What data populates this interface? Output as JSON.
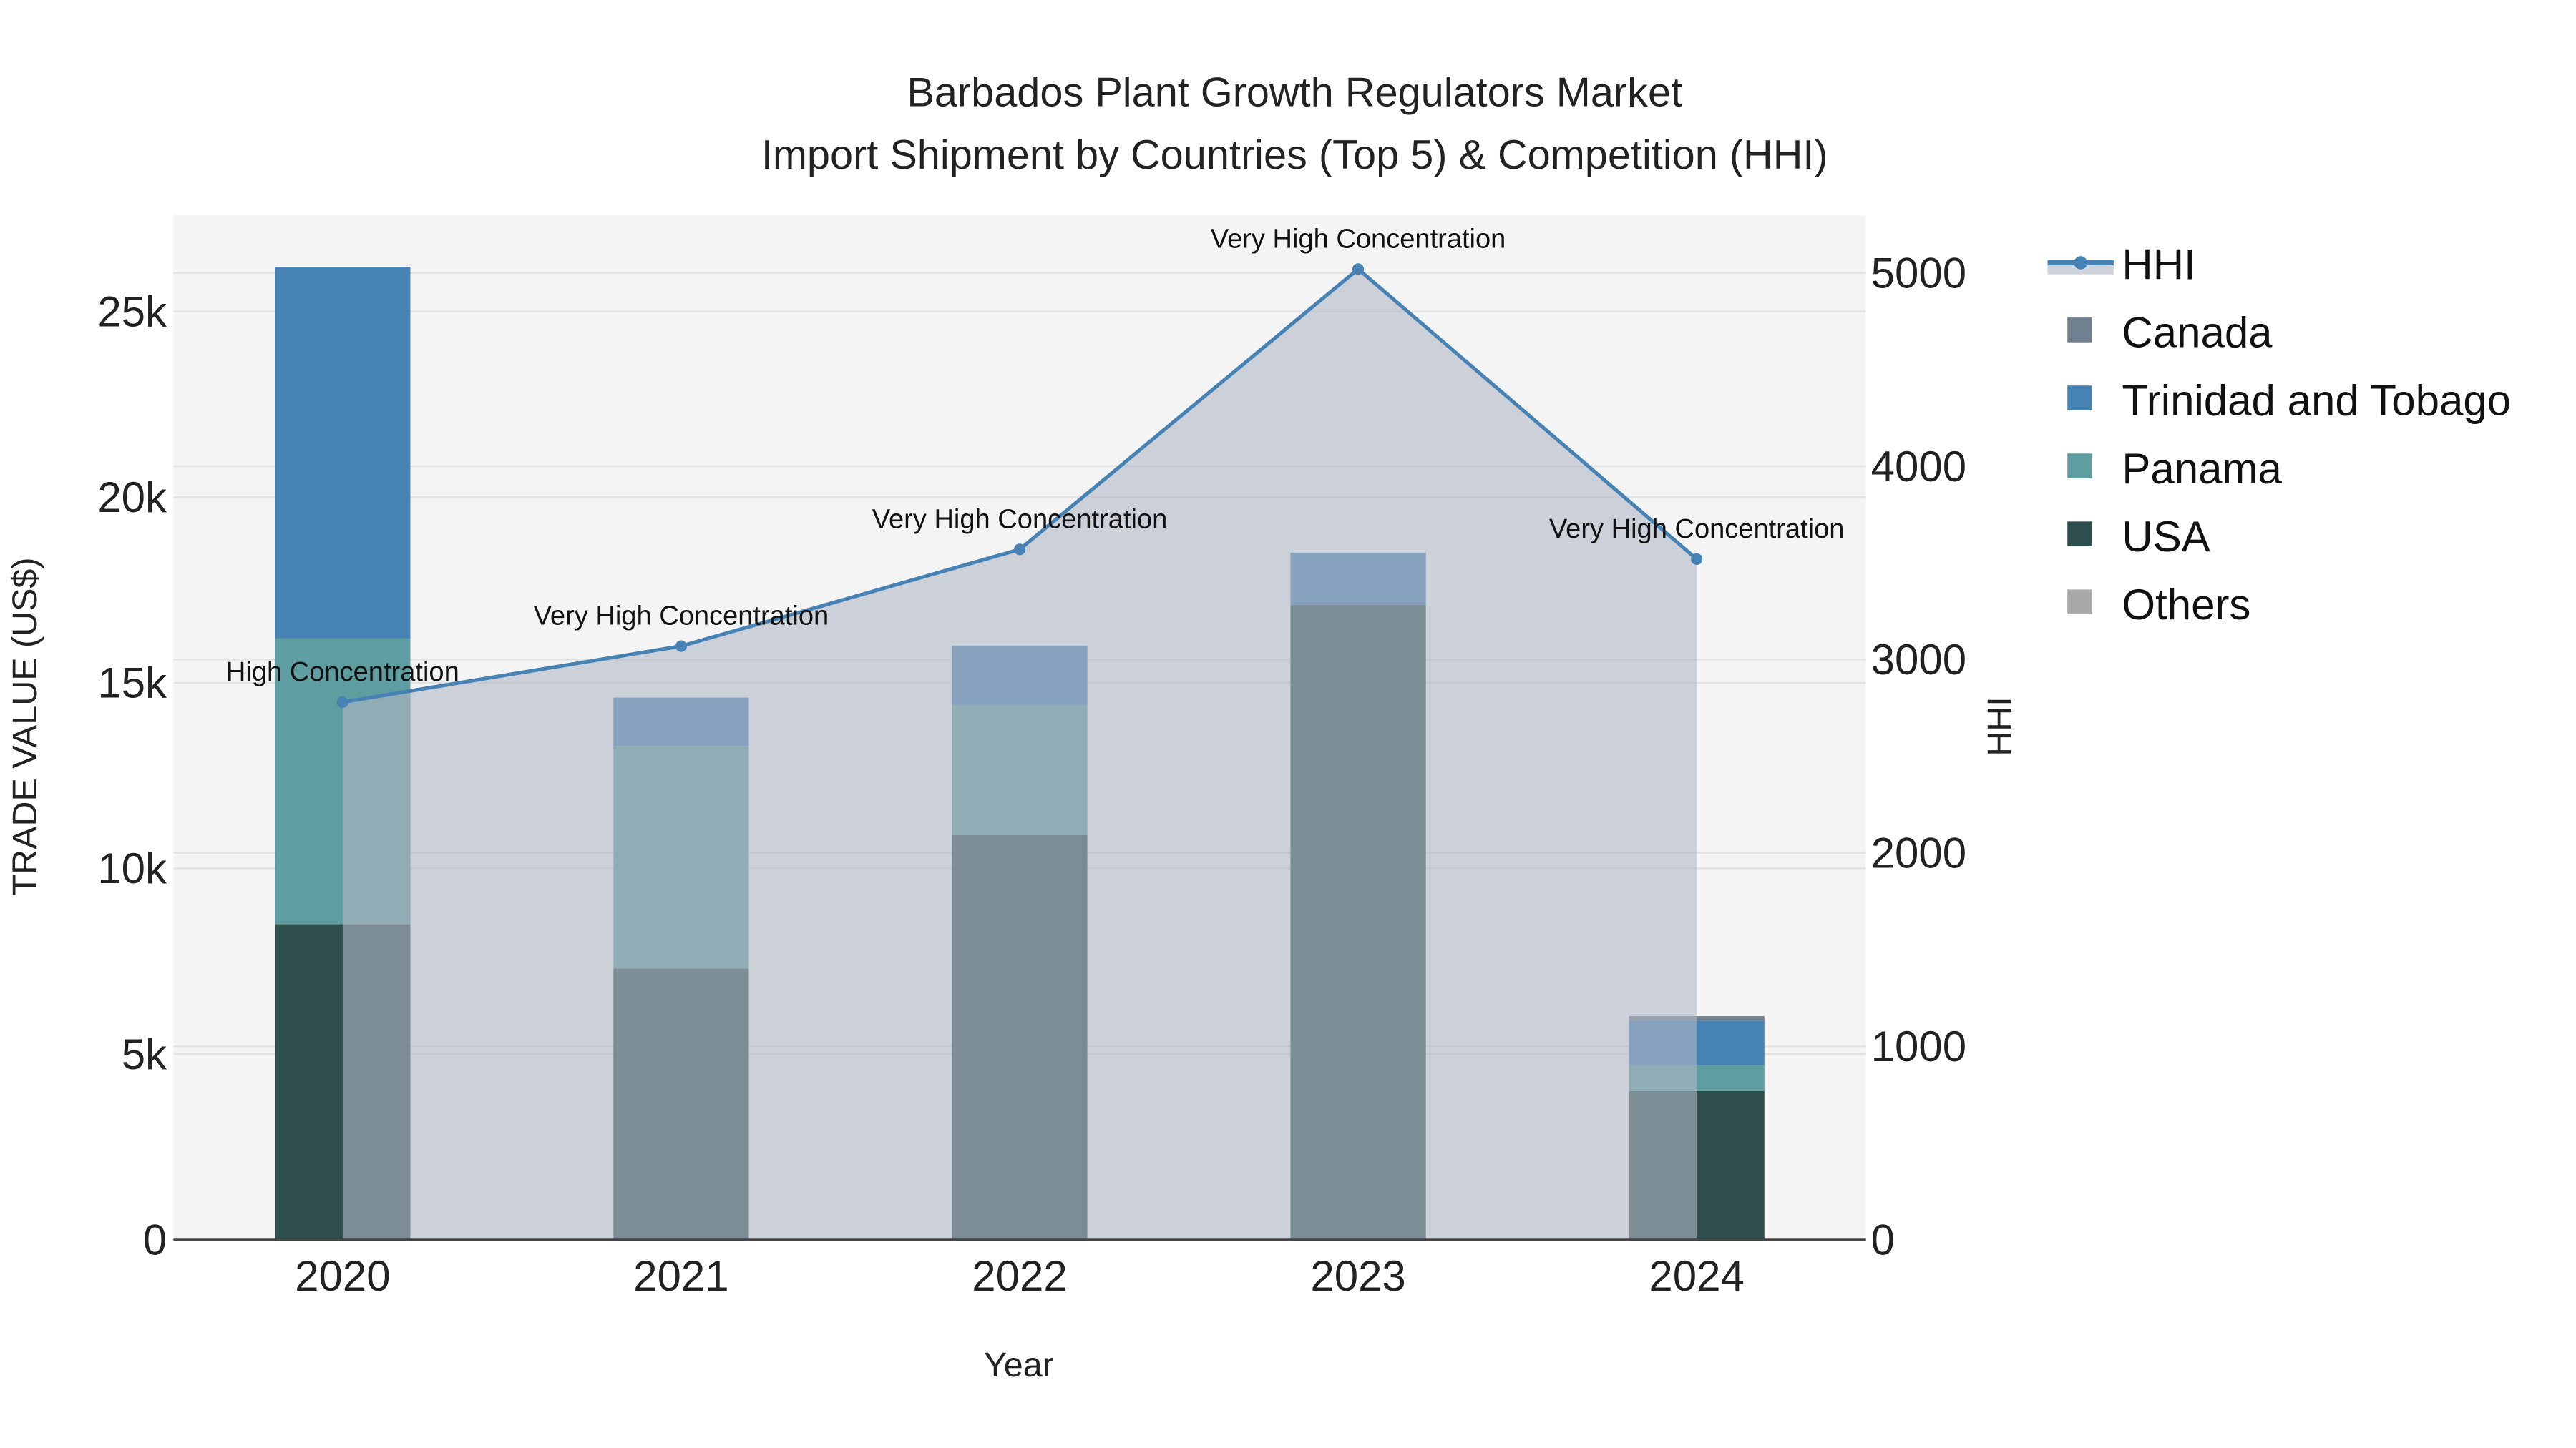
{
  "chart_data": {
    "type": "bar",
    "title": "Barbados Plant Growth Regulators Market",
    "subtitle": "Import Shipment by Countries (Top 5) & Competition (HHI)",
    "xlabel": "Year",
    "ylabel": "TRADE VALUE (US$)",
    "y2label": "HHI",
    "categories": [
      "2020",
      "2021",
      "2022",
      "2023",
      "2024"
    ],
    "ylim": [
      0,
      27600
    ],
    "y2lim": [
      0,
      5300
    ],
    "yticks": [
      0,
      5000,
      10000,
      15000,
      20000,
      25000
    ],
    "ytick_labels": [
      "0",
      "5k",
      "10k",
      "15k",
      "20k",
      "25k"
    ],
    "y2ticks": [
      0,
      1000,
      2000,
      3000,
      4000,
      5000
    ],
    "y2tick_labels": [
      "0",
      "1000",
      "2000",
      "3000",
      "4000",
      "5000"
    ],
    "legend_position": "right",
    "series": [
      {
        "name": "USA",
        "color": "#2f4f4f",
        "values": [
          8500,
          7300,
          10900,
          17100,
          4000
        ]
      },
      {
        "name": "Panama",
        "color": "#5f9ea0",
        "values": [
          7700,
          6000,
          3500,
          0,
          700
        ]
      },
      {
        "name": "Trinidad and Tobago",
        "color": "#4682b4",
        "values": [
          10000,
          1300,
          1600,
          1400,
          1200
        ]
      },
      {
        "name": "Canada",
        "color": "#708090",
        "values": [
          0,
          0,
          0,
          0,
          120
        ]
      },
      {
        "name": "Others",
        "color": "#a9a9a9",
        "values": [
          0,
          0,
          0,
          0,
          0
        ]
      }
    ],
    "legend_order": [
      "HHI",
      "Canada",
      "Trinidad and Tobago",
      "Panama",
      "USA",
      "Others"
    ],
    "hhi": {
      "name": "HHI",
      "color": "#4682b4",
      "values": [
        2780,
        3070,
        3570,
        5020,
        3520
      ],
      "annotations": [
        "High Concentration",
        "Very High Concentration",
        "Very High Concentration",
        "Very High Concentration",
        "Very High Concentration"
      ]
    }
  }
}
